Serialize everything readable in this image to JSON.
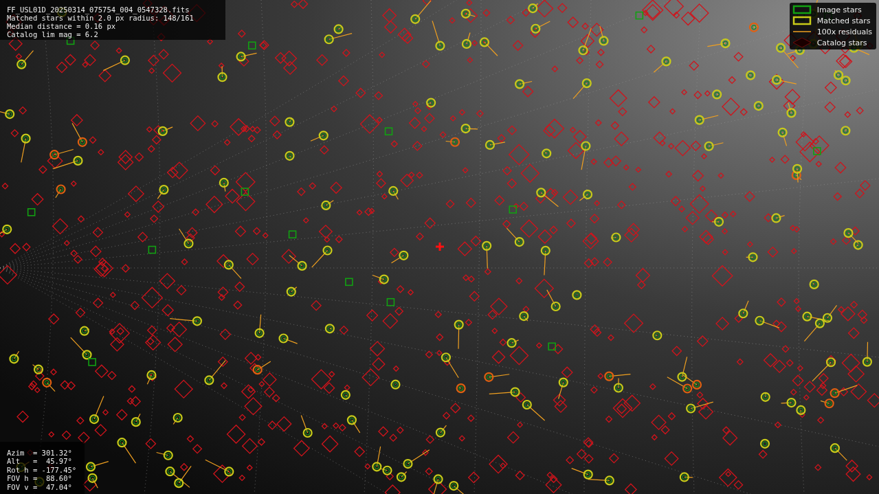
{
  "info_panel": {
    "lines": [
      "FF_USL01D_20250314_075754_004_0547328.fits",
      "Matched stars within 2.0 px radius: 148/161",
      "Median distance = 0.16 px",
      "Catalog lim mag = 6.2"
    ]
  },
  "legend": {
    "items": [
      {
        "label": "Image stars",
        "kind": "image"
      },
      {
        "label": "Matched stars",
        "kind": "matched"
      },
      {
        "label": "100x residuals",
        "kind": "residual"
      },
      {
        "label": "Catalog stars",
        "kind": "catalog"
      }
    ]
  },
  "pointing_panel": {
    "lines": [
      "Azim  = 301.32°",
      "Alt   =  45.97°",
      "Rot h = -177.45°",
      "FOV h =  88.60°",
      "FOV v =  47.04°"
    ]
  }
}
